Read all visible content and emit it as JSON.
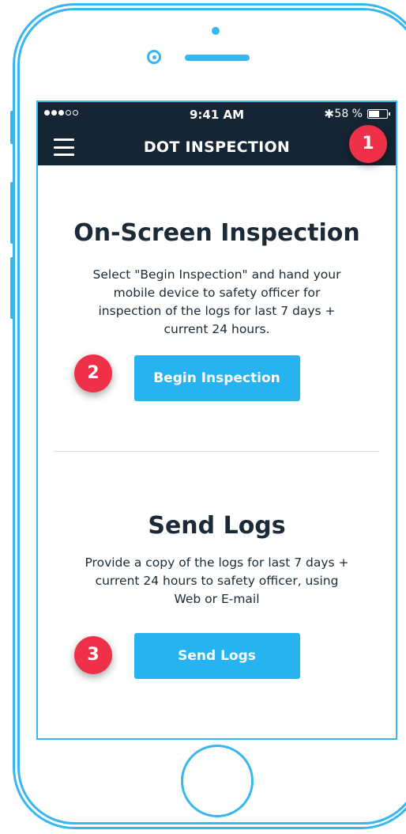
{
  "status_bar": {
    "time": "9:41 AM",
    "bluetooth_icon": "bluetooth-icon",
    "battery_percent": "58 %",
    "battery_level": 0.58,
    "signal_bars": 3
  },
  "nav": {
    "title": "DOT INSPECTION",
    "menu_icon": "hamburger-menu-icon"
  },
  "on_screen": {
    "title": "On-Screen Inspection",
    "description": "Select \"Begin Inspection\" and hand your mobile device to safety officer for inspection of the logs for last 7 days + current 24 hours.",
    "button_label": "Begin Inspection"
  },
  "send_logs": {
    "title": "Send Logs",
    "description": "Provide a copy of the logs for last 7 days + current 24 hours to safety officer, using Web or E-mail",
    "button_label": "Send Logs"
  },
  "badges": {
    "one": "1",
    "two": "2",
    "three": "3"
  },
  "colors": {
    "header_bg": "#152533",
    "accent": "#26b3f0",
    "badge": "#ee3048",
    "outline": "#38b6ee"
  }
}
